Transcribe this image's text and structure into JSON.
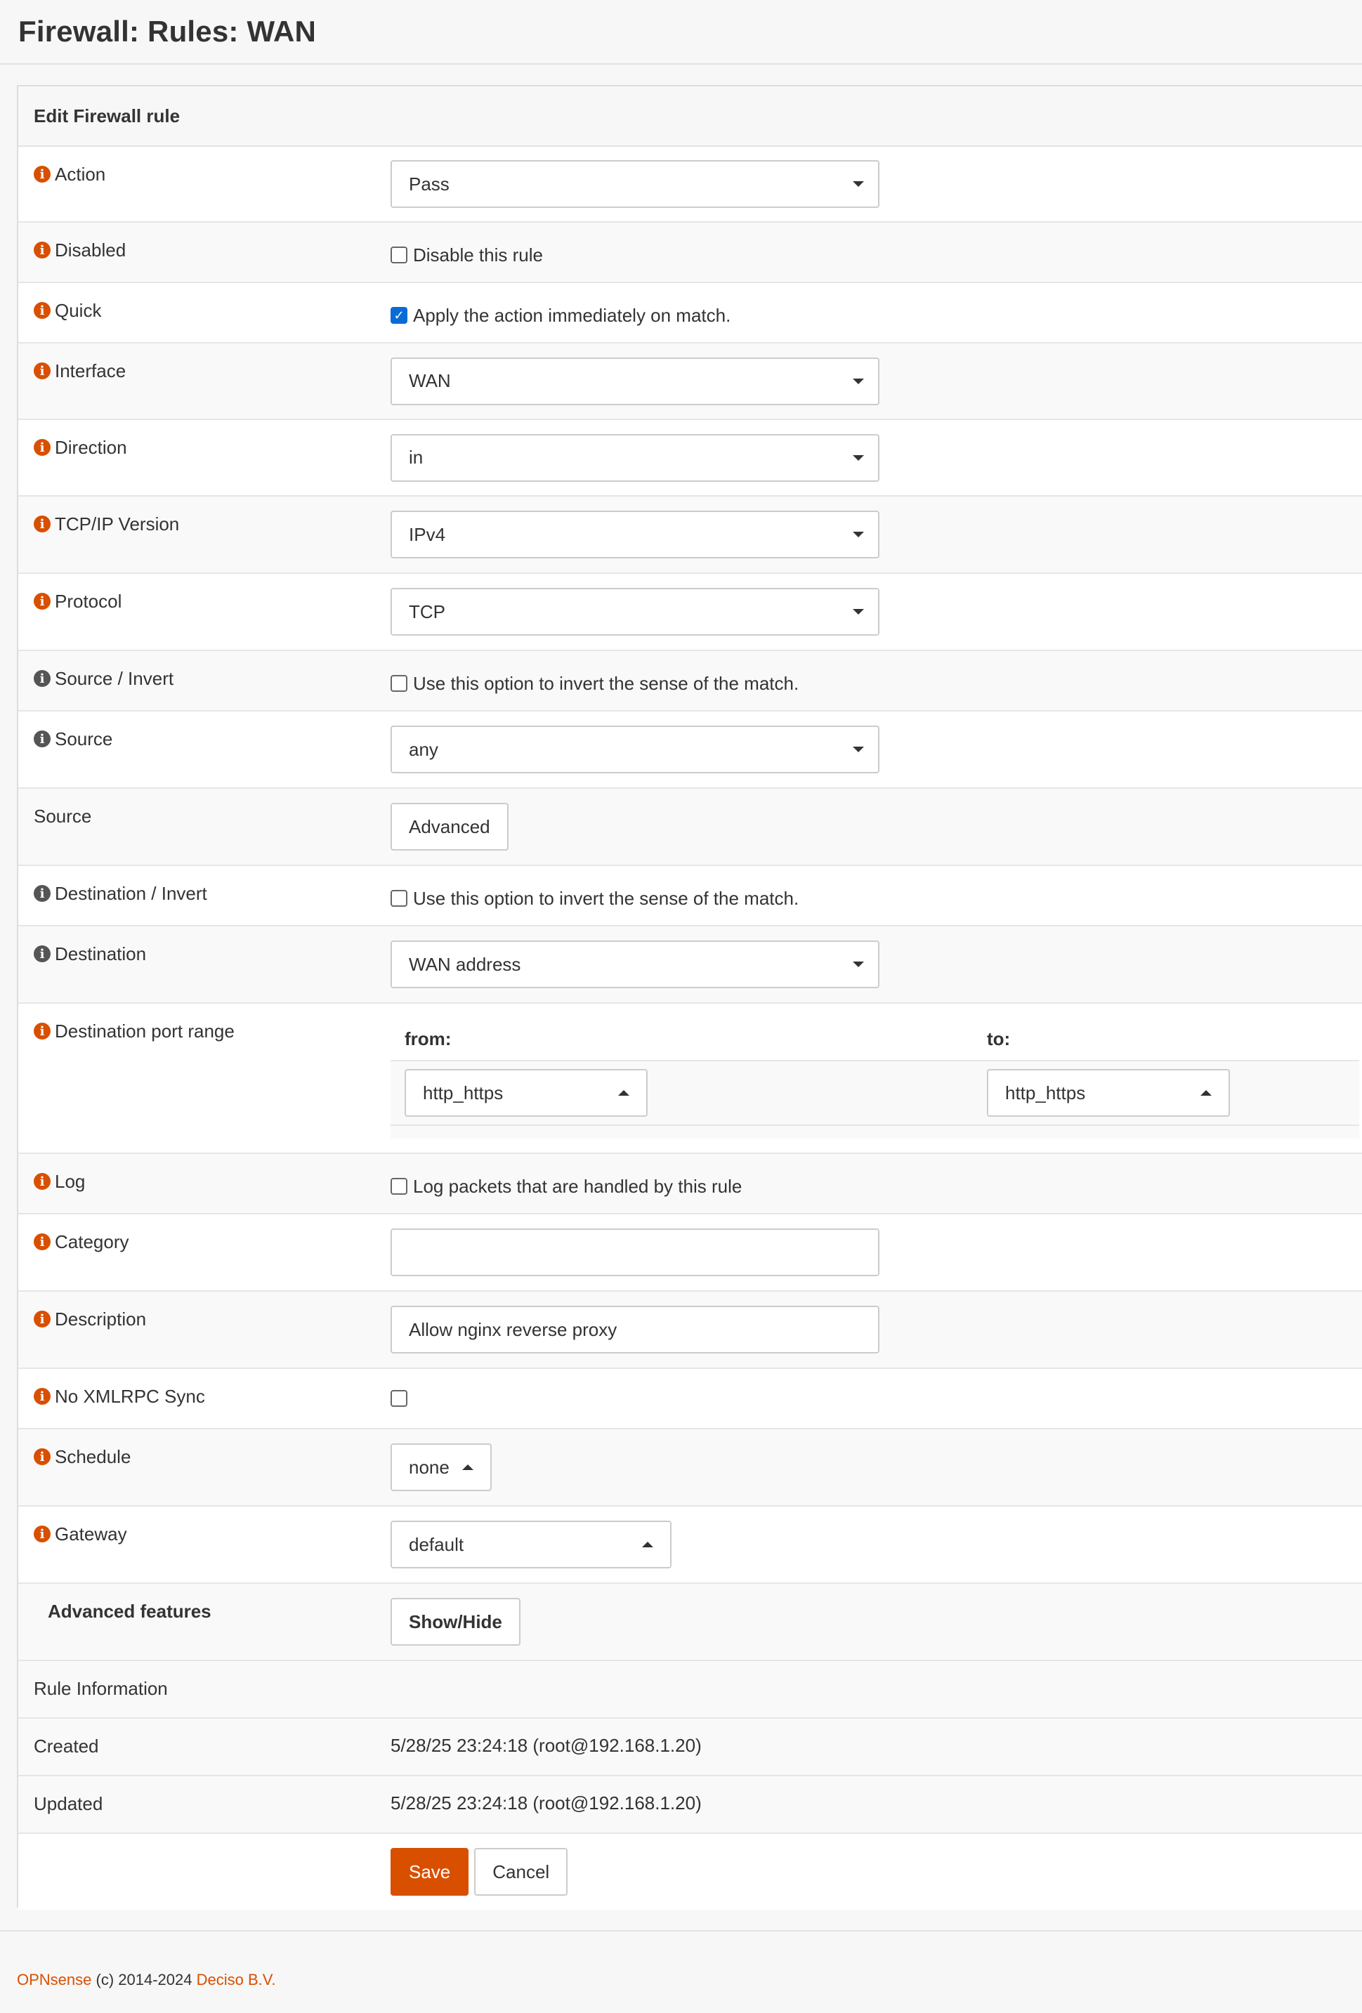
{
  "page": {
    "title": "Firewall: Rules: WAN"
  },
  "panel": {
    "heading": "Edit Firewall rule"
  },
  "fields": {
    "action": {
      "label": "Action",
      "value": "Pass"
    },
    "disabled": {
      "label": "Disabled",
      "text": "Disable this rule",
      "checked": false
    },
    "quick": {
      "label": "Quick",
      "text": "Apply the action immediately on match.",
      "checked": true
    },
    "interface": {
      "label": "Interface",
      "value": "WAN"
    },
    "direction": {
      "label": "Direction",
      "value": "in"
    },
    "ipversion": {
      "label": "TCP/IP Version",
      "value": "IPv4"
    },
    "protocol": {
      "label": "Protocol",
      "value": "TCP"
    },
    "source_invert": {
      "label": "Source / Invert",
      "text": "Use this option to invert the sense of the match.",
      "checked": false
    },
    "source": {
      "label": "Source",
      "value": "any"
    },
    "source_advanced": {
      "label": "Source",
      "button": "Advanced"
    },
    "destination_invert": {
      "label": "Destination / Invert",
      "text": "Use this option to invert the sense of the match.",
      "checked": false
    },
    "destination": {
      "label": "Destination",
      "value": "WAN address"
    },
    "dest_port_range": {
      "label": "Destination port range",
      "from_label": "from:",
      "to_label": "to:",
      "from_value": "http_https",
      "to_value": "http_https"
    },
    "log": {
      "label": "Log",
      "text": "Log packets that are handled by this rule",
      "checked": false
    },
    "category": {
      "label": "Category",
      "value": ""
    },
    "description": {
      "label": "Description",
      "value": "Allow nginx reverse proxy"
    },
    "no_xmlrpc_sync": {
      "label": "No XMLRPC Sync",
      "checked": false
    },
    "schedule": {
      "label": "Schedule",
      "value": "none"
    },
    "gateway": {
      "label": "Gateway",
      "value": "default"
    },
    "advanced_features": {
      "label": "Advanced features",
      "button": "Show/Hide"
    }
  },
  "rule_info": {
    "heading": "Rule Information",
    "created_label": "Created",
    "created_value": "5/28/25 23:24:18 (root@192.168.1.20)",
    "updated_label": "Updated",
    "updated_value": "5/28/25 23:24:18 (root@192.168.1.20)"
  },
  "buttons": {
    "save": "Save",
    "cancel": "Cancel"
  },
  "footer": {
    "brand": "OPNsense",
    "copyright": "(c) 2014-2024",
    "company": "Deciso B.V."
  },
  "colors": {
    "accent": "#d94f00",
    "checkbox_checked": "#0b6bd6"
  },
  "icons": {
    "info": "info-circle-icon",
    "select_caret": "caret-down-icon",
    "port_caret": "caret-up-icon"
  }
}
